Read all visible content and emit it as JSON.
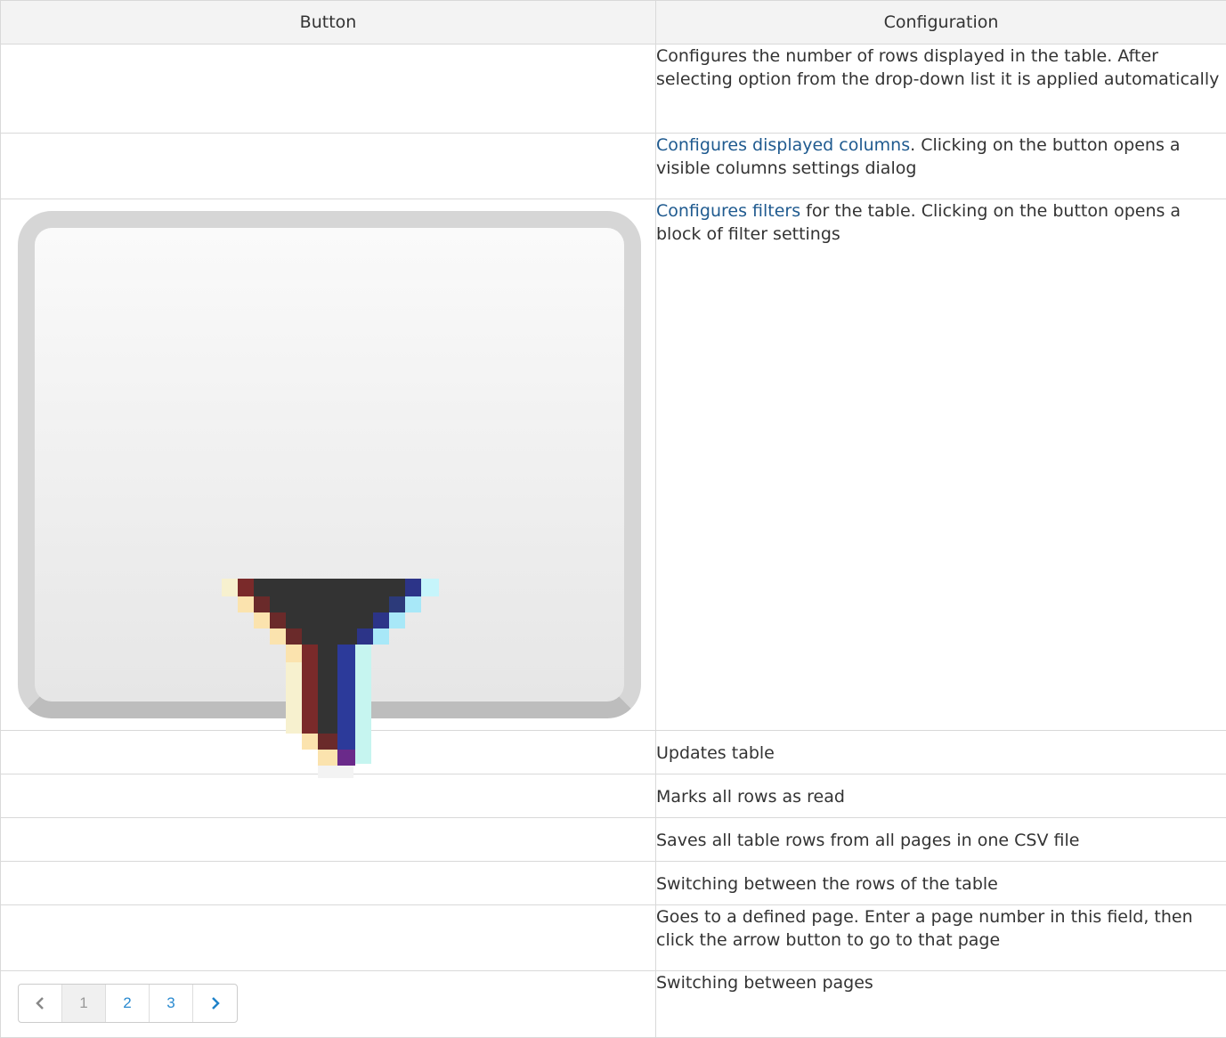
{
  "header": {
    "button": "Button",
    "configuration": "Configuration"
  },
  "rows": [
    {
      "description": "Configures the number of rows displayed in the table. After selecting option from the drop-down list it is applied automatically"
    },
    {
      "link": "Configures displayed columns",
      "description": ". Clicking on the button opens a visible columns settings dialog"
    },
    {
      "link": "Configures filters",
      "description": " for the table. Clicking on the button opens a block of filter settings",
      "icon": "filter-icon"
    },
    {
      "description": "Updates table"
    },
    {
      "description": "Marks all rows as read"
    },
    {
      "description": "Saves all table rows from all pages in one CSV file"
    },
    {
      "description": "Switching between the rows of the table"
    },
    {
      "description": "Goes to a defined page. Enter a page number in this field, then click the arrow button to go to that page"
    },
    {
      "description": "Switching between pages",
      "pager": {
        "prev": "‹",
        "pages": [
          "1",
          "2",
          "3"
        ],
        "current": "1",
        "next": "›"
      }
    }
  ],
  "colors": {
    "link": "#1f5a8f",
    "pager_link": "#2a8ad0",
    "border": "#d9d9d9",
    "header_bg": "#f3f3f3"
  }
}
